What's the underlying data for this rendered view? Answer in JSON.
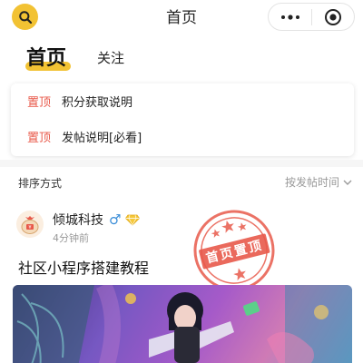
{
  "navbar": {
    "title": "首页",
    "search_icon": "search-icon",
    "more_icon": "more-dots-icon",
    "close_icon": "target-close-icon"
  },
  "tabs": [
    {
      "label": "首页",
      "active": true
    },
    {
      "label": "关注",
      "active": false
    }
  ],
  "pinned": [
    {
      "tag": "置顶",
      "text": "积分获取说明"
    },
    {
      "tag": "置顶",
      "text": "发帖说明[必看]"
    }
  ],
  "sort": {
    "label": "排序方式",
    "selected": "按发帖时间"
  },
  "post": {
    "author": "倾城科技",
    "gender_symbol": "♂",
    "time": "4分钟前",
    "title": "社区小程序搭建教程",
    "stamp_text": "首页置顶"
  },
  "colors": {
    "accent": "#f2c233",
    "pinned_tag": "#e8594a",
    "stamp": "#e8594a",
    "gender": "#3b8ed8"
  }
}
